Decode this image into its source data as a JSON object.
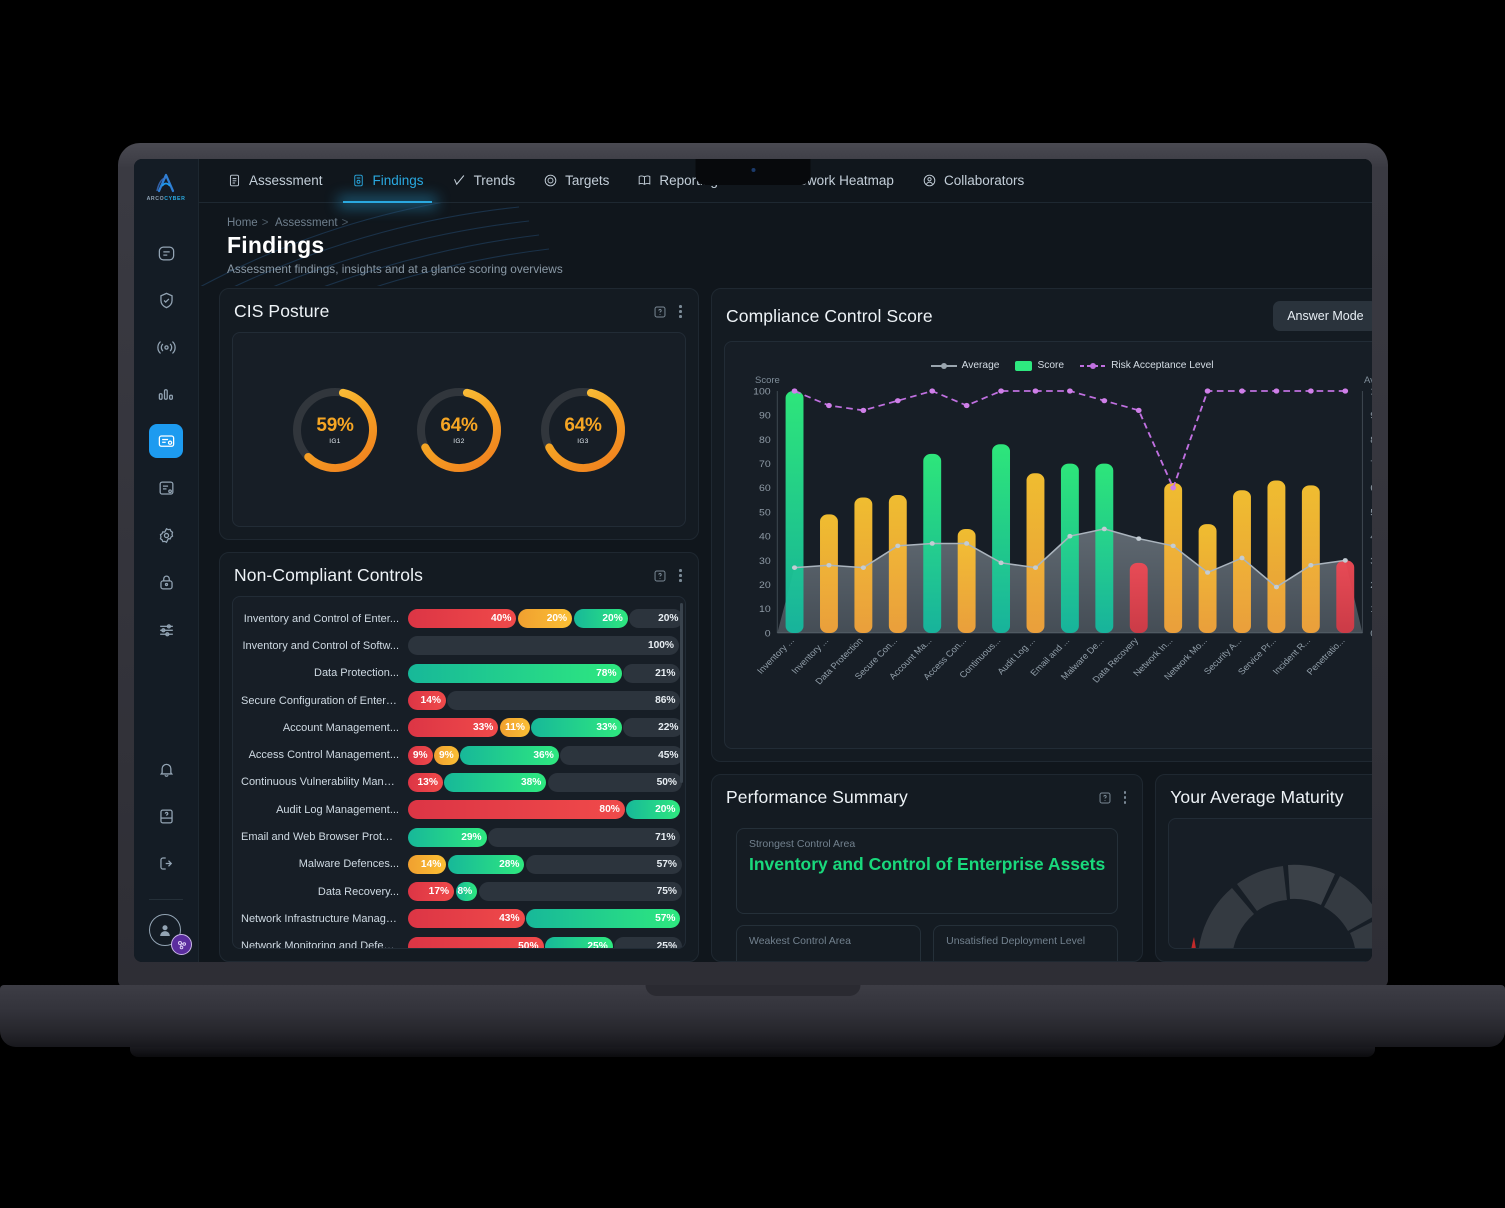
{
  "brand": {
    "name_main": "ARCO",
    "name_accent": "CYBER"
  },
  "topbar": {
    "tabs": [
      {
        "label": "Assessment",
        "icon": "clipboard-icon",
        "active": false
      },
      {
        "label": "Findings",
        "icon": "findings-icon",
        "active": true
      },
      {
        "label": "Trends",
        "icon": "trend-icon",
        "active": false
      },
      {
        "label": "Targets",
        "icon": "target-icon",
        "active": false
      },
      {
        "label": "Reporting",
        "icon": "book-icon",
        "active": false
      },
      {
        "label": "Framework Heatmap",
        "icon": "heatmap-icon",
        "active": false
      },
      {
        "label": "Collaborators",
        "icon": "user-circle-icon",
        "active": false
      }
    ]
  },
  "sidebar": {
    "items": [
      {
        "icon": "home-icon",
        "name": "home"
      },
      {
        "icon": "shield-check-icon",
        "name": "security"
      },
      {
        "icon": "broadcast-icon",
        "name": "broadcast"
      },
      {
        "icon": "bar-chart-icon",
        "name": "analytics"
      },
      {
        "icon": "certificate-icon",
        "name": "assessments"
      },
      {
        "icon": "report-icon",
        "name": "reports"
      },
      {
        "icon": "gear-icon",
        "name": "settings"
      },
      {
        "icon": "lock-icon",
        "name": "access"
      },
      {
        "icon": "sliders-icon",
        "name": "preferences"
      }
    ],
    "bottom_items": [
      {
        "icon": "bell-icon",
        "name": "notifications"
      },
      {
        "icon": "help-book-icon",
        "name": "help"
      },
      {
        "icon": "logout-icon",
        "name": "logout"
      }
    ]
  },
  "header": {
    "breadcrumb": [
      "Home",
      "Assessment"
    ],
    "title": "Findings",
    "subtitle": "Assessment findings, insights and at a glance scoring overviews"
  },
  "cis_posture": {
    "title": "CIS Posture",
    "gauges": [
      {
        "value": 59,
        "display": "59%",
        "label": "IG1"
      },
      {
        "value": 64,
        "display": "64%",
        "label": "IG2"
      },
      {
        "value": 64,
        "display": "64%",
        "label": "IG3"
      }
    ]
  },
  "non_compliant": {
    "title": "Non-Compliant Controls",
    "rows": [
      {
        "label": "Inventory and Control of Enter...",
        "segments": [
          {
            "color": "red",
            "value": 40,
            "display": "40%"
          },
          {
            "color": "orange",
            "value": 20,
            "display": "20%"
          },
          {
            "color": "green",
            "value": 20,
            "display": "20%"
          },
          {
            "color": "gray",
            "value": 20,
            "display": "20%"
          }
        ]
      },
      {
        "label": "Inventory and Control of Softw...",
        "segments": [
          {
            "color": "gray",
            "value": 100,
            "display": "100%"
          }
        ]
      },
      {
        "label": "Data Protection...",
        "segments": [
          {
            "color": "green",
            "value": 78,
            "display": "78%"
          },
          {
            "color": "gray",
            "value": 21,
            "display": "21%"
          }
        ]
      },
      {
        "label": "Secure Configuration of Enterp...",
        "segments": [
          {
            "color": "red",
            "value": 14,
            "display": "14%"
          },
          {
            "color": "gray",
            "value": 86,
            "display": "86%"
          }
        ]
      },
      {
        "label": "Account Management...",
        "segments": [
          {
            "color": "red",
            "value": 33,
            "display": "33%"
          },
          {
            "color": "orange",
            "value": 11,
            "display": "11%"
          },
          {
            "color": "green",
            "value": 33,
            "display": "33%"
          },
          {
            "color": "gray",
            "value": 22,
            "display": "22%"
          }
        ]
      },
      {
        "label": "Access Control Management...",
        "segments": [
          {
            "color": "red",
            "value": 9,
            "display": "9%"
          },
          {
            "color": "orange",
            "value": 9,
            "display": "9%"
          },
          {
            "color": "green",
            "value": 36,
            "display": "36%"
          },
          {
            "color": "gray",
            "value": 45,
            "display": "45%"
          }
        ]
      },
      {
        "label": "Continuous Vulnerability Manag...",
        "segments": [
          {
            "color": "red",
            "value": 13,
            "display": "13%"
          },
          {
            "color": "green",
            "value": 38,
            "display": "38%"
          },
          {
            "color": "gray",
            "value": 50,
            "display": "50%"
          }
        ]
      },
      {
        "label": "Audit Log Management...",
        "segments": [
          {
            "color": "red",
            "value": 80,
            "display": "80%"
          },
          {
            "color": "green",
            "value": 20,
            "display": "20%"
          }
        ]
      },
      {
        "label": "Email and Web Browser Protecti...",
        "segments": [
          {
            "color": "green",
            "value": 29,
            "display": "29%"
          },
          {
            "color": "gray",
            "value": 71,
            "display": "71%"
          }
        ]
      },
      {
        "label": "Malware Defences...",
        "segments": [
          {
            "color": "orange",
            "value": 14,
            "display": "14%"
          },
          {
            "color": "green",
            "value": 28,
            "display": "28%"
          },
          {
            "color": "gray",
            "value": 57,
            "display": "57%"
          }
        ]
      },
      {
        "label": "Data Recovery...",
        "segments": [
          {
            "color": "red",
            "value": 17,
            "display": "17%"
          },
          {
            "color": "green",
            "value": 8,
            "display": "8%"
          },
          {
            "color": "gray",
            "value": 75,
            "display": "75%"
          }
        ]
      },
      {
        "label": "Network Infrastructure Managem...",
        "segments": [
          {
            "color": "red",
            "value": 43,
            "display": "43%"
          },
          {
            "color": "green",
            "value": 57,
            "display": "57%"
          }
        ]
      },
      {
        "label": "Network Monitoring and Defence...",
        "segments": [
          {
            "color": "red",
            "value": 50,
            "display": "50%"
          },
          {
            "color": "green",
            "value": 25,
            "display": "25%"
          },
          {
            "color": "gray",
            "value": 25,
            "display": "25%"
          }
        ]
      }
    ]
  },
  "compliance": {
    "title": "Compliance Control Score",
    "answer_mode_label": "Answer Mode"
  },
  "chart_data": {
    "type": "bar",
    "title": "Compliance Control Score",
    "ylabel": "Score",
    "y2label": "Average",
    "ylim": [
      0,
      100
    ],
    "y2lim": [
      0,
      100
    ],
    "yticks": [
      0,
      10,
      20,
      30,
      40,
      50,
      60,
      70,
      80,
      90,
      100
    ],
    "grid": false,
    "legend_position": "top-center",
    "legend": [
      "Average",
      "Score",
      "Risk Acceptance Level"
    ],
    "categories": [
      "Inventory ...",
      "Inventory ...",
      "Data Protection",
      "Secure Con...",
      "Account Ma...",
      "Access Con...",
      "Continuous...",
      "Audit Log ...",
      "Email and ...",
      "Malware De...",
      "Data Recovery",
      "Network In...",
      "Network Mo...",
      "Security A...",
      "Service Pr...",
      "Incident R...",
      "Penetratio..."
    ],
    "series": [
      {
        "name": "Score",
        "type": "bar",
        "values": [
          100,
          49,
          56,
          57,
          74,
          43,
          78,
          66,
          70,
          70,
          29,
          62,
          45,
          59,
          63,
          61,
          30
        ]
      },
      {
        "name": "Average",
        "type": "area-line",
        "color": "#9aa5ae",
        "values": [
          27,
          28,
          27,
          36,
          37,
          37,
          29,
          27,
          40,
          43,
          39,
          36,
          25,
          31,
          19,
          28,
          30
        ]
      },
      {
        "name": "Risk Acceptance Level",
        "type": "dashed-line",
        "color": "#c070e0",
        "values": [
          100,
          94,
          92,
          96,
          100,
          94,
          100,
          100,
          100,
          96,
          92,
          60,
          100,
          100,
          100,
          100,
          100
        ]
      }
    ],
    "bar_colors": [
      "green",
      "yellow",
      "yellow",
      "yellow",
      "green",
      "yellow",
      "green",
      "yellow",
      "green",
      "green",
      "red",
      "yellow",
      "yellow",
      "yellow",
      "yellow",
      "yellow",
      "red"
    ]
  },
  "performance": {
    "title": "Performance Summary",
    "strongest_label": "Strongest Control Area",
    "strongest_value": "Inventory and Control of Enterprise Assets",
    "weakest_label": "Weakest Control Area",
    "unsatisfied_label": "Unsatisfied Deployment Level"
  },
  "maturity": {
    "title": "Your Average Maturity"
  },
  "colors": {
    "accent": "#2aa9e0",
    "green": "#2ee87f",
    "yellow": "#fbbf34",
    "red": "#e8424f",
    "purple": "#c070e0",
    "gray_line": "#9aa5ae",
    "gauge": "#f5a524"
  }
}
